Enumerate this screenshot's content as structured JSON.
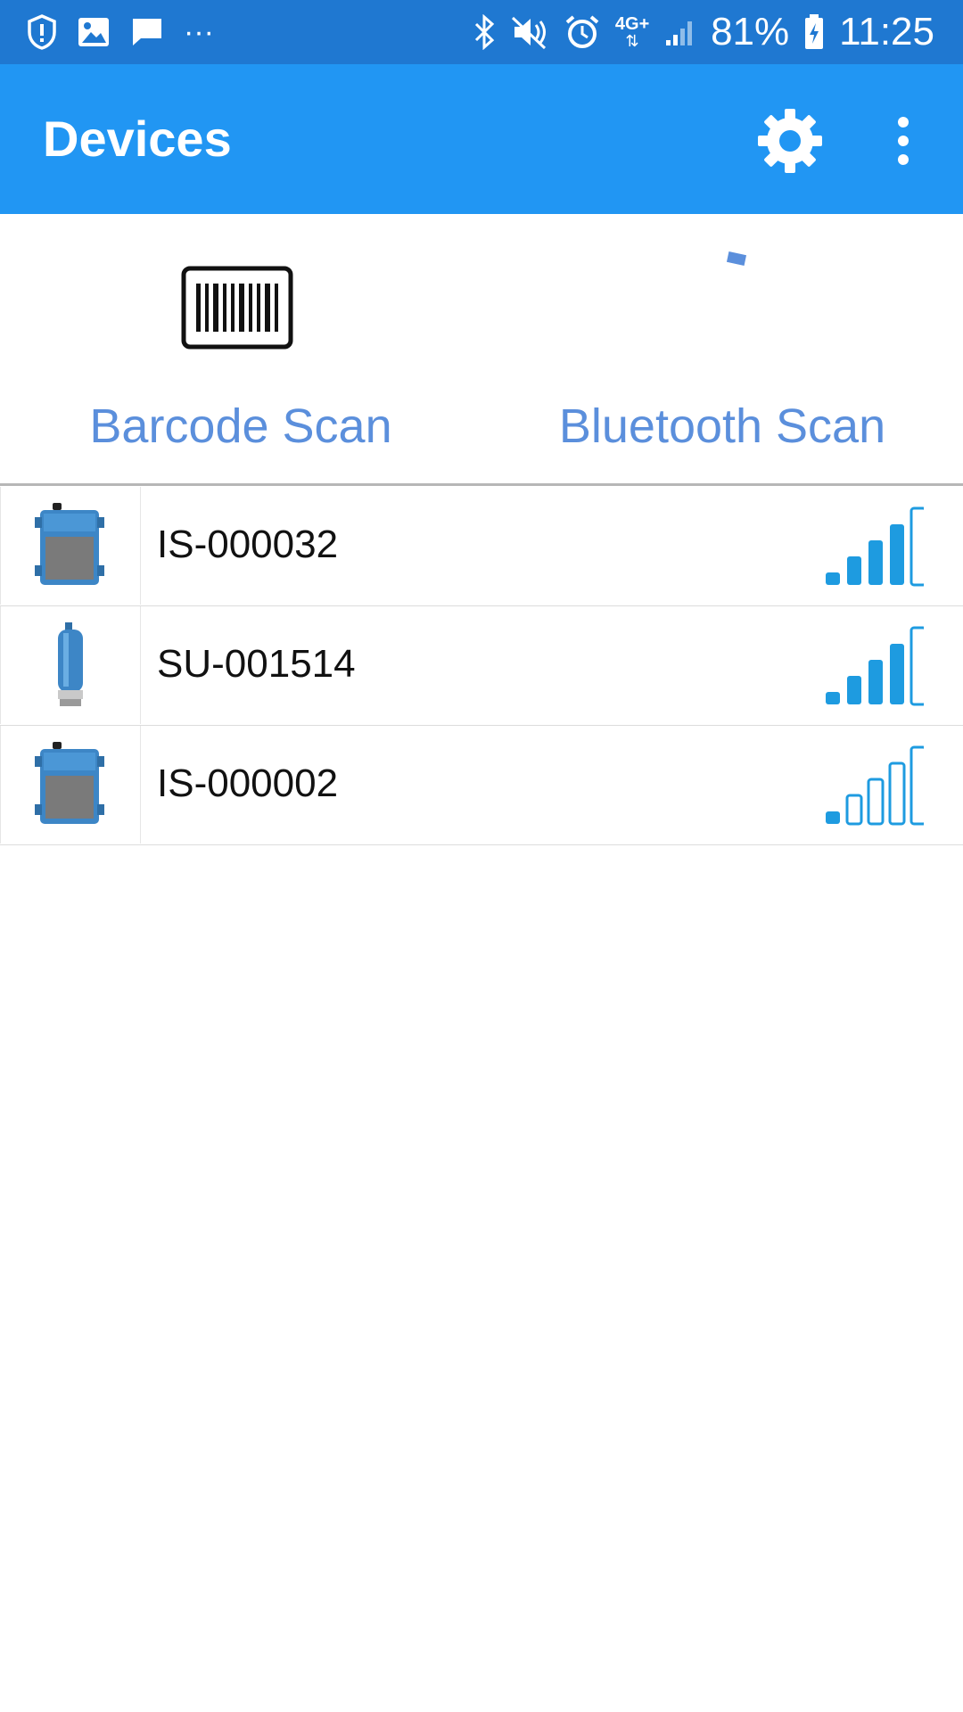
{
  "status_bar": {
    "icons_left": [
      "shield-alert-icon",
      "image-icon",
      "message-icon",
      "more-notifications-icon"
    ],
    "more_text": "···",
    "icons_right": [
      "bluetooth-icon",
      "mute-icon",
      "alarm-icon",
      "network-4g-icon",
      "cell-signal-icon",
      "battery-charging-icon"
    ],
    "network_label": "4G+",
    "battery": "81%",
    "time": "11:25"
  },
  "app_bar": {
    "title": "Devices",
    "actions": [
      "gear-icon",
      "overflow-menu-icon"
    ]
  },
  "scan": {
    "barcode_label": "Barcode Scan",
    "bluetooth_label": "Bluetooth Scan",
    "barcode_icon": "barcode-icon",
    "bluetooth_icon": "loading-spinner-icon"
  },
  "devices": [
    {
      "name": "IS-000032",
      "image": "box-sensor-device",
      "signal_bars": 4,
      "max_bars": 5
    },
    {
      "name": "SU-001514",
      "image": "cylinder-sensor-device",
      "signal_bars": 4,
      "max_bars": 5
    },
    {
      "name": "IS-000002",
      "image": "box-sensor-device",
      "signal_bars": 1,
      "max_bars": 5
    }
  ],
  "colors": {
    "status_bar": "#1f78d1",
    "app_bar": "#2196f3",
    "accent_text": "#5b8fdc",
    "signal": "#1e9be0"
  }
}
